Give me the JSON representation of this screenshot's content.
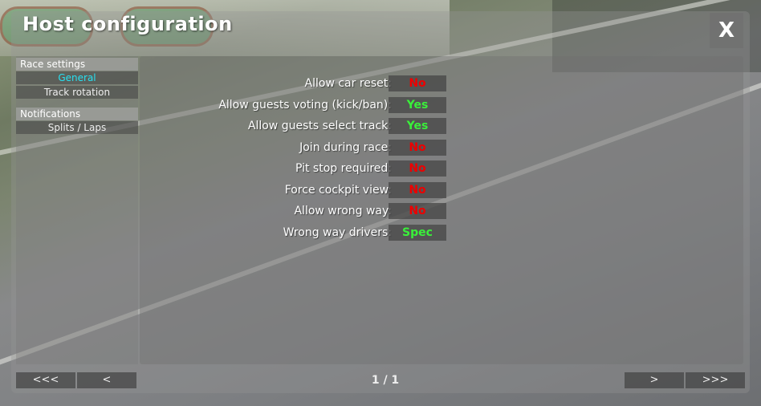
{
  "window": {
    "title": "Host configuration",
    "close_label": "X"
  },
  "sidebar": {
    "sections": [
      {
        "header": "Race settings",
        "items": [
          {
            "label": "General",
            "active": true
          },
          {
            "label": "Track rotation",
            "active": false
          }
        ]
      },
      {
        "header": "Notifications",
        "items": [
          {
            "label": "Splits / Laps",
            "active": false
          }
        ]
      }
    ]
  },
  "settings": [
    {
      "label": "Allow car reset:",
      "value": "No"
    },
    {
      "label": "Allow guests voting (kick/ban):",
      "value": "Yes"
    },
    {
      "label": "Allow guests select track:",
      "value": "Yes"
    },
    {
      "label": "Join during race:",
      "value": "No"
    },
    {
      "label": "Pit stop required:",
      "value": "No"
    },
    {
      "label": "Force cockpit view:",
      "value": "No"
    },
    {
      "label": "Allow wrong way:",
      "value": "No"
    },
    {
      "label": "Wrong way drivers:",
      "value": "Spec"
    }
  ],
  "footer": {
    "first_label": "<<<",
    "prev_label": "<",
    "page_indicator": "1 / 1",
    "next_label": ">",
    "last_label": ">>>"
  },
  "colors": {
    "active_item": "#27e0f0",
    "value_no": "#ee0000",
    "value_yes": "#3af03a"
  }
}
